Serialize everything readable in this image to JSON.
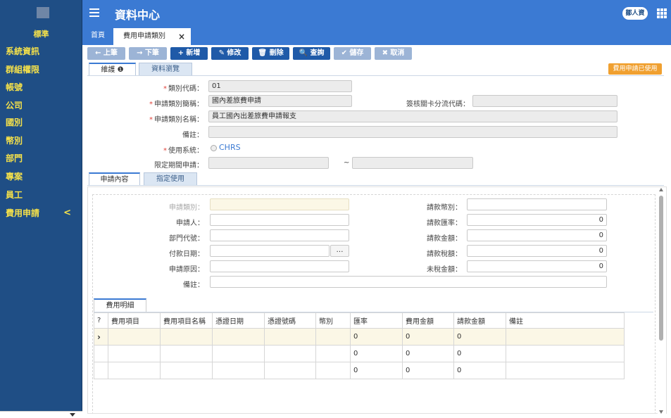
{
  "sidebar": {
    "heading": "標準",
    "items": [
      "系統資訊",
      "群組權限",
      "帳號",
      "公司",
      "國別",
      "幣別",
      "部門",
      "專案",
      "員工",
      "費用申請"
    ],
    "chevron": "<"
  },
  "header": {
    "title": "資料中心",
    "user": "鄒人資"
  },
  "tabs": {
    "home": "首頁",
    "active": "費用申請類別",
    "close": "×"
  },
  "toolbar": {
    "prev": "← 上筆",
    "next": "→ 下筆",
    "add": "+ 新增",
    "edit": "✎ 修改",
    "delete": "🗑 刪除",
    "query": "🔍 查詢",
    "save": "✔ 儲存",
    "cancel": "✖ 取消"
  },
  "inner_tabs": {
    "maintain": "維護 ❶",
    "browse": "資料瀏覽"
  },
  "badge": "費用申請已使用",
  "form": {
    "type_code_label": "類別代碼：",
    "type_code": "01",
    "type_short_label": "申請類別簡稱：",
    "type_short": "國內差旅費申請",
    "approve_code_label": "簽核關卡分流代碼：",
    "approve_code": "",
    "type_name_label": "申請類別名稱：",
    "type_name": "員工國內出差旅費申請報支",
    "note_label": "備註：",
    "note": "",
    "system_label": "使用系統：",
    "system": "CHRS",
    "period_label": "限定期間申請：",
    "tilde": "~"
  },
  "section_tabs": {
    "content": "申請內容",
    "assign": "指定使用"
  },
  "panel": {
    "apply_type_label": "申請類別：",
    "applicant_label": "申請人：",
    "dept_label": "部門代號：",
    "pay_date_label": "付款日期：",
    "reason_label": "申請原因：",
    "note_label": "備註：",
    "currency_label": "請款幣別：",
    "rate_label": "請款匯率：",
    "rate": "0",
    "amount_label": "請款金額：",
    "amount": "0",
    "tax_label": "請款稅額：",
    "tax": "0",
    "untaxed_label": "未稅金額：",
    "untaxed": "0",
    "ellipsis": "…"
  },
  "detail": {
    "tab": "費用明細",
    "columns": [
      "?",
      "費用項目",
      "費用項目名稱",
      "憑證日期",
      "憑證號碼",
      "幣別",
      "匯率",
      "費用金額",
      "請款金額",
      "備註"
    ],
    "rows": [
      [
        "",
        "",
        "",
        "",
        "",
        "0",
        "0",
        "0",
        ""
      ],
      [
        "",
        "",
        "",
        "",
        "",
        "0",
        "0",
        "0",
        ""
      ],
      [
        "",
        "",
        "",
        "",
        "",
        "0",
        "0",
        "0",
        ""
      ]
    ]
  }
}
